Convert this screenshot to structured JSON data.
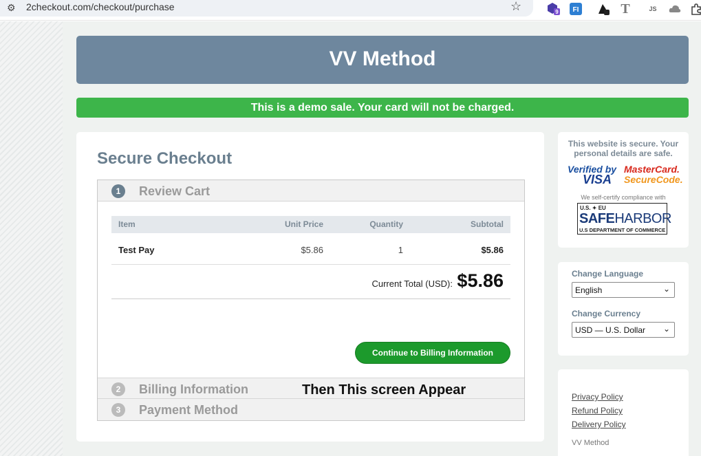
{
  "browser": {
    "url": "2checkout.com/checkout/purchase",
    "star_icon": "☆",
    "ext1_badge": "9",
    "ext2_text": "FI",
    "ext4_text": "T",
    "ext5_text": "JS"
  },
  "header": {
    "title": "VV Method"
  },
  "demo_banner": {
    "text": "This is a demo sale. Your card will not be charged."
  },
  "checkout": {
    "title": "Secure Checkout",
    "steps": [
      {
        "num": "1",
        "label": "Review Cart"
      },
      {
        "num": "2",
        "label": "Billing Information"
      },
      {
        "num": "3",
        "label": "Payment Method"
      }
    ],
    "table": {
      "headers": [
        "Item",
        "Unit Price",
        "Quantity",
        "Subtotal"
      ],
      "rows": [
        {
          "item": "Test Pay",
          "unit_price": "$5.86",
          "quantity": "1",
          "subtotal": "$5.86"
        }
      ],
      "total_label": "Current Total (USD):",
      "total_amount": "$5.86"
    },
    "continue_label": "Continue to Billing Information"
  },
  "annotation": "Then This screen Appear",
  "sidebar": {
    "secure_msg": "This website is secure. Your personal details are safe.",
    "visa_top": "Verified by",
    "visa_bottom": "VISA",
    "mc_top": "MasterCard.",
    "mc_bottom": "SecureCode.",
    "self_cert": "We self-certify compliance with",
    "sh_top": "U.S. ✦ EU",
    "sh_main_a": "SAFE",
    "sh_main_b": "HARBOR",
    "sh_bottom": "U.S DEPARTMENT OF COMMERCE",
    "language_label": "Change Language",
    "language_value": "English",
    "currency_label": "Change Currency",
    "currency_value": "USD — U.S. Dollar",
    "links": [
      "Privacy Policy",
      "Refund Policy",
      "Delivery Policy"
    ],
    "brand": "VV Method"
  }
}
